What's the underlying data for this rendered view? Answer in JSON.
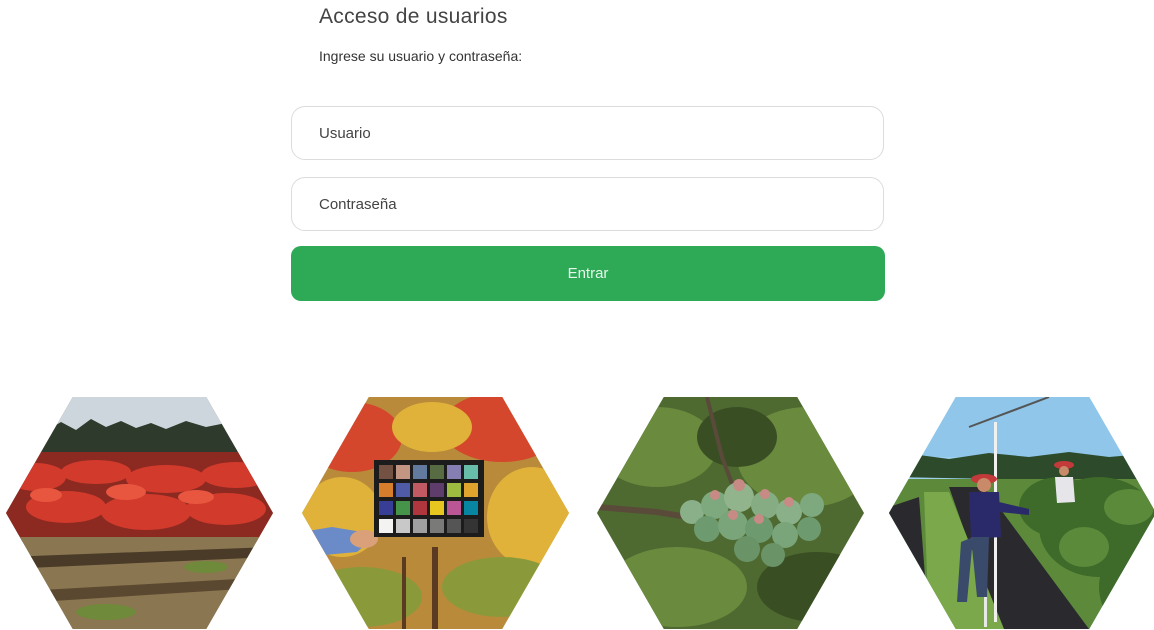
{
  "login": {
    "title": "Acceso de usuarios",
    "subtitle": "Ingrese su usuario y contraseña:",
    "user_placeholder": "Usuario",
    "password_placeholder": "Contraseña",
    "submit_label": "Entrar"
  },
  "colors": {
    "button": "#2eaa57",
    "button_text": "#e8f6ec",
    "field_border": "#dcdcdc"
  },
  "gallery": [
    {
      "name": "blueberry-field-red-foliage-photo"
    },
    {
      "name": "color-checker-chart-photo"
    },
    {
      "name": "blueberry-cluster-photo"
    },
    {
      "name": "field-workers-photo"
    }
  ]
}
